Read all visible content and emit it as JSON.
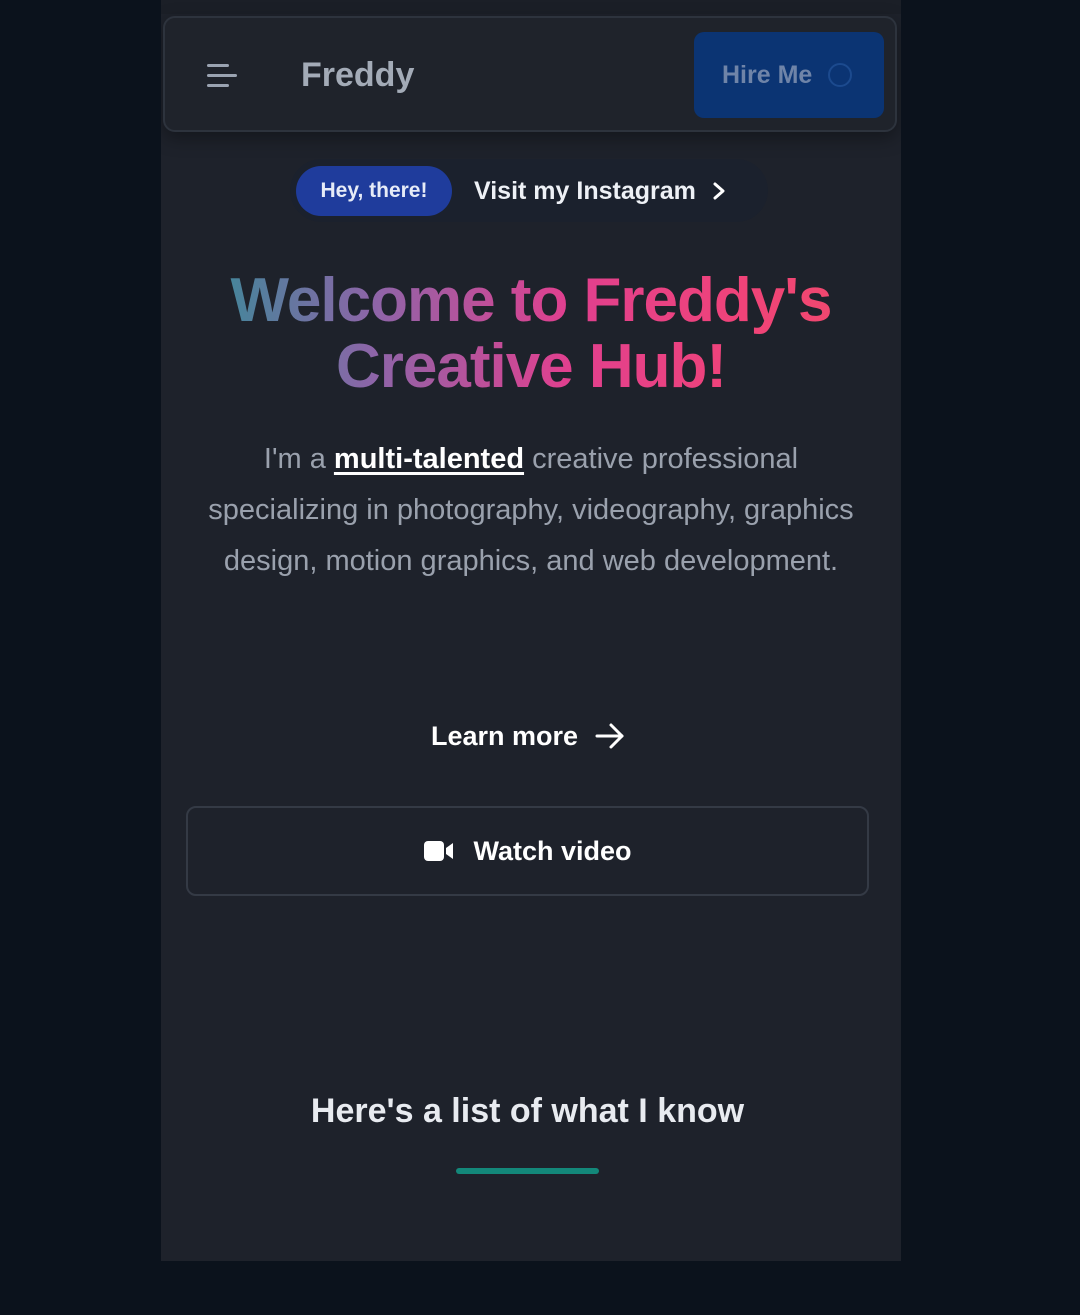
{
  "navbar": {
    "brand": "Freddy",
    "hire_label": "Hire Me"
  },
  "announcement": {
    "badge": "Hey, there!",
    "link_text": "Visit my Instagram"
  },
  "hero": {
    "title_line1": "Welcome to Freddy's",
    "title_line2": "Creative Hub!",
    "desc_prefix": "I'm a ",
    "desc_highlight": "multi-talented",
    "desc_suffix": " creative professional specializing in photography, videography, graphics design, motion graphics, and web development.",
    "learn_more_label": "Learn more",
    "watch_video_label": "Watch video"
  },
  "skills_section": {
    "title": "Here's a list of what I know"
  },
  "colors": {
    "background": "#0b121c",
    "surface": "#1e222b",
    "hire_button": "#0b3473",
    "badge": "#1f3c9c",
    "accent_bar": "#13887a"
  },
  "icons": {
    "menu": "hamburger-menu-icon",
    "pill_chevron": "chevron-right-icon",
    "learn_more": "arrow-right-icon",
    "watch_video": "video-camera-icon"
  }
}
